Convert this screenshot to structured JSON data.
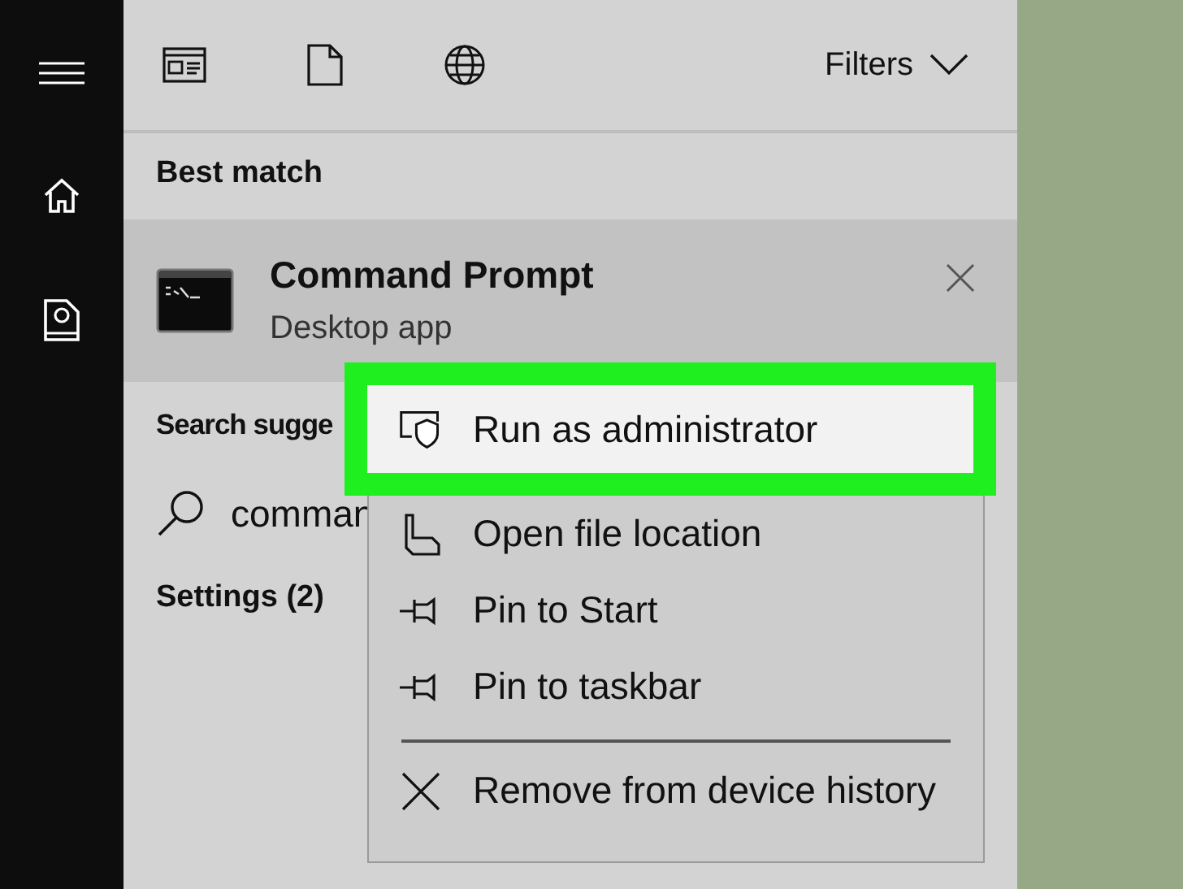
{
  "toolbar": {
    "filters": "Filters"
  },
  "best_match": {
    "heading": "Best match",
    "result": {
      "title": "Command Prompt",
      "subtitle": "Desktop app"
    }
  },
  "suggestions": {
    "heading": "Search sugge",
    "items": [
      {
        "text": "comman"
      }
    ]
  },
  "settings": {
    "heading": "Settings (2)"
  },
  "context_menu": {
    "groups": [
      [
        {
          "kind": "admin",
          "label": "Run as administrator",
          "selected": true
        },
        {
          "kind": "location",
          "label": "Open file location",
          "selected": false
        },
        {
          "kind": "pin",
          "label": "Pin to Start",
          "selected": false
        },
        {
          "kind": "pin",
          "label": "Pin to taskbar",
          "selected": false
        }
      ],
      [
        {
          "kind": "remove",
          "label": "Remove from device history",
          "selected": false
        }
      ]
    ]
  }
}
